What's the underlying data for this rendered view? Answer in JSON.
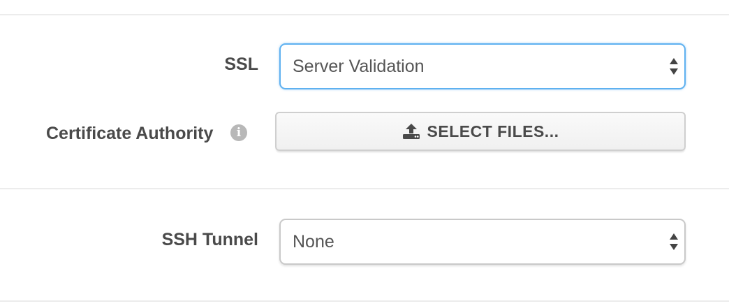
{
  "ssl": {
    "label": "SSL",
    "selected": "Server Validation"
  },
  "certificate_authority": {
    "label": "Certificate Authority",
    "info_icon": "info-circle-icon",
    "button_label": "SELECT FILES...",
    "button_icon": "upload-icon"
  },
  "ssh_tunnel": {
    "label": "SSH Tunnel",
    "selected": "None"
  },
  "colors": {
    "focus_border": "#5fb1f0",
    "label_text": "#4a4a4a",
    "divider": "#ececec"
  }
}
